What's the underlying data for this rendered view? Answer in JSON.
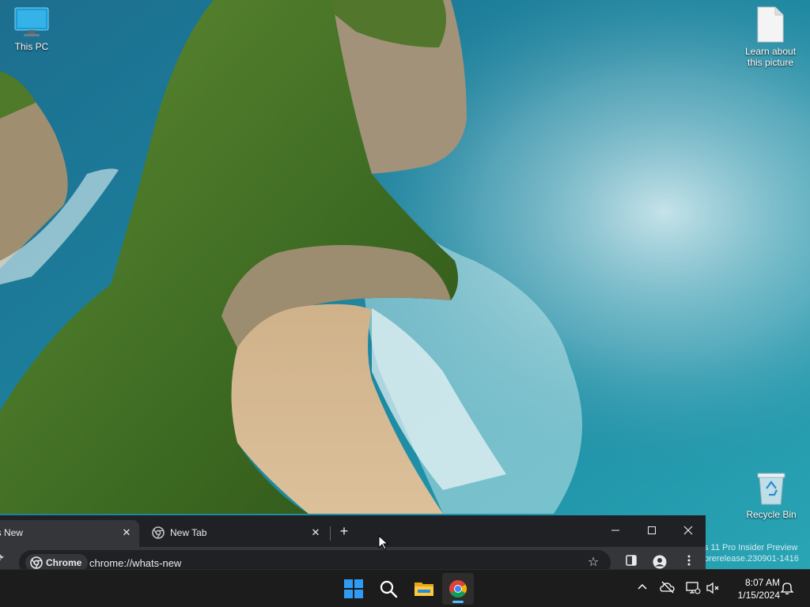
{
  "desktop": {
    "icons": [
      {
        "label": "This PC"
      },
      {
        "label": "Learn about this picture"
      },
      {
        "label": "Recycle Bin"
      }
    ],
    "watermark": {
      "line1": "s 11 Pro Insider Preview",
      "line2": "prerelease.230901-1416"
    }
  },
  "browser": {
    "tabs": [
      {
        "title": "t's New",
        "active": true
      },
      {
        "title": "New Tab",
        "active": false
      }
    ],
    "new_tab_label": "+",
    "omnibox": {
      "chip_label": "Chrome",
      "url": "chrome://whats-new"
    }
  },
  "taskbar": {
    "pinned": [
      "windows-start-icon",
      "search-icon",
      "file-explorer-icon",
      "chrome-icon"
    ],
    "clock": {
      "time": "8:07 AM",
      "date": "1/15/2024"
    }
  },
  "colors": {
    "accent": "#4cc2ff",
    "chrome_dark": "#202124",
    "chrome_toolbar": "#35363a",
    "taskbar": "#1c1c1c"
  }
}
